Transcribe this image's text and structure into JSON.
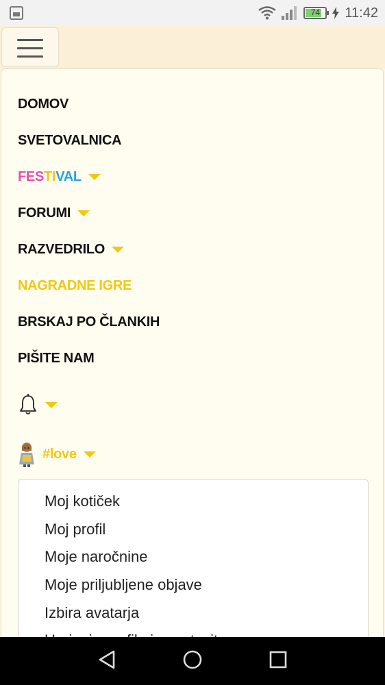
{
  "status_bar": {
    "battery": "74",
    "time": "11:42"
  },
  "menu": {
    "items": [
      {
        "label": "DOMOV"
      },
      {
        "label": "SVETOVALNICA"
      },
      {
        "label": "FESTIVAL",
        "parts": [
          "FES",
          "TI",
          "VAL"
        ]
      },
      {
        "label": "FORUMI"
      },
      {
        "label": "RAZVEDRILO"
      },
      {
        "label": "NAGRADNE IGRE"
      },
      {
        "label": "BRSKAJ PO ČLANKIH"
      },
      {
        "label": "PIŠITE NAM"
      }
    ],
    "username": "#love"
  },
  "user_dropdown": {
    "items": [
      "Moj kotiček",
      "Moj profil",
      "Moje naročnine",
      "Moje priljubljene objave",
      "Izbira avatarja",
      "Urejanje profila in nastavitev"
    ]
  },
  "colors": {
    "accent_yellow": "#f2c811",
    "festival_pink": "#e64fb3",
    "festival_blue": "#20a8e0",
    "background": "#fdf6e3"
  }
}
